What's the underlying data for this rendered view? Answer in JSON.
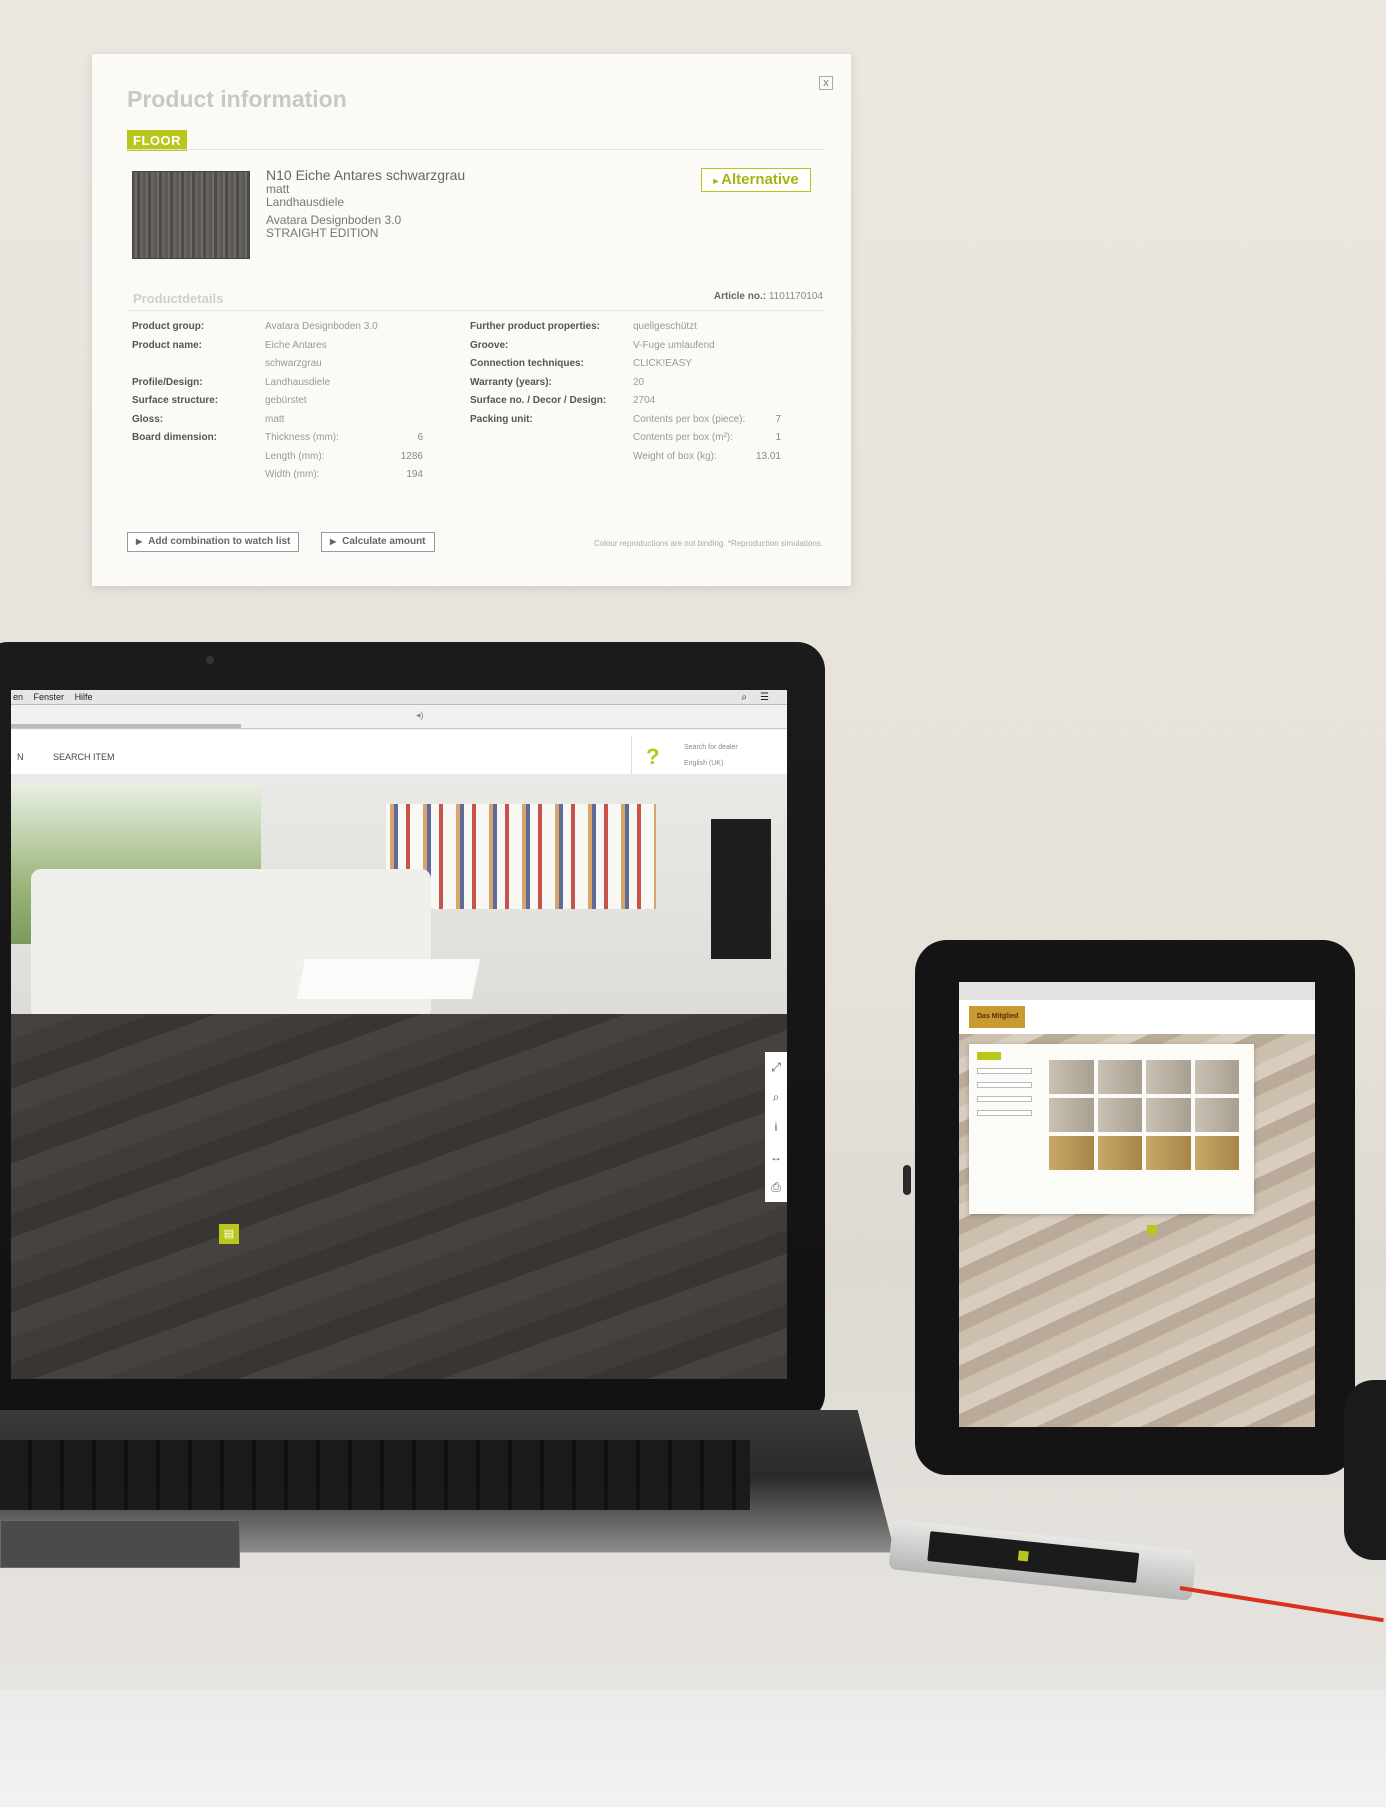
{
  "panel": {
    "title": "Product information",
    "close_label": "x",
    "tag": "FLOOR",
    "product": {
      "name": "N10 Eiche Antares schwarzgrau",
      "gloss": "matt",
      "design": "Landhausdiele",
      "series": "Avatara Designboden 3.0",
      "edition": "STRAIGHT EDITION"
    },
    "alternative_label": "Alternative",
    "details_title": "Productdetails",
    "article_label": "Article no.:",
    "article_value": "1101170104",
    "left_rows": [
      {
        "label": "Product group:",
        "value": "Avatara Designboden 3.0"
      },
      {
        "label": "Product name:",
        "value": "Eiche Antares schwarzgrau"
      },
      {
        "label": "Profile/Design:",
        "value": "Landhausdiele"
      },
      {
        "label": "Surface structure:",
        "value": "gebürstet"
      },
      {
        "label": "Gloss:",
        "value": "matt"
      },
      {
        "label": "Board dimension:",
        "value": "Thickness (mm):",
        "num": "6"
      },
      {
        "label": "",
        "value": "Length (mm):",
        "num": "1286"
      },
      {
        "label": "",
        "value": "Width (mm):",
        "num": "194"
      }
    ],
    "right_rows": [
      {
        "label": "Further product properties:",
        "value": "quellgeschützt"
      },
      {
        "label": "Groove:",
        "value": "V-Fuge umlaufend"
      },
      {
        "label": "Connection techniques:",
        "value": "CLICK!EASY"
      },
      {
        "label": "Warranty (years):",
        "value": "20"
      },
      {
        "label": "Surface no. / Decor / Design:",
        "value": "2704"
      },
      {
        "label": "Packing unit:",
        "value": "Contents per box (piece):",
        "num": "7"
      },
      {
        "label": "",
        "value": "Contents per box (m²):",
        "num": "1"
      },
      {
        "label": "",
        "value": "Weight of box (kg):",
        "num": "13.01"
      }
    ],
    "watch_list_button": "Add combination to watch list",
    "calculate_button": "Calculate amount",
    "disclaimer": "Colour reproductions are not binding. *Reproduction simulations."
  },
  "laptop": {
    "menu": [
      "en",
      "Fenster",
      "Hilfe"
    ],
    "search_icon": "search-icon",
    "nav_prev": "N",
    "nav_item": "SEARCH ITEM",
    "help_glyph": "?",
    "help_lines": [
      "Search for dealer",
      "English (UK)"
    ]
  },
  "tablet": {
    "logo": "Das Mitglied"
  },
  "colors": {
    "accent": "#b9c61b",
    "panel_bg": "#fbfaf6"
  }
}
